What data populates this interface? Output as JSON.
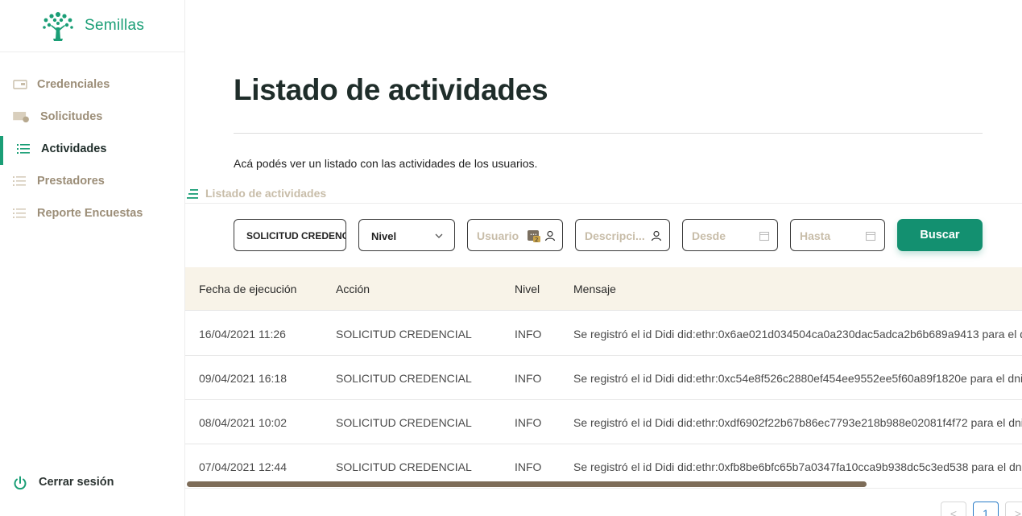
{
  "brand": {
    "name": "Semillas",
    "color": "#1a9e76"
  },
  "sidebar": {
    "items": [
      {
        "label": "Credenciales",
        "icon": "card-icon",
        "active": false
      },
      {
        "label": "Solicitudes",
        "icon": "folder-icon",
        "active": false
      },
      {
        "label": "Actividades",
        "icon": "list-icon",
        "active": true
      },
      {
        "label": "Prestadores",
        "icon": "list-icon",
        "active": false
      },
      {
        "label": "Reporte Encuestas",
        "icon": "list-icon",
        "active": false
      }
    ],
    "logout_label": "Cerrar sesión"
  },
  "main": {
    "title": "Listado de actividades",
    "subtitle": "Acá podés ver un listado con las actividades de los usuarios.",
    "section_label": "Listado de actividades"
  },
  "filters": {
    "action_value": "SOLICITUD CREDENCIAL",
    "level_value": "Nivel",
    "user_placeholder": "Usuario",
    "description_placeholder": "Descripci...",
    "from_placeholder": "Desde",
    "to_placeholder": "Hasta",
    "search_label": "Buscar"
  },
  "table": {
    "columns": [
      "Fecha de ejecución",
      "Acción",
      "Nivel",
      "Mensaje"
    ],
    "rows": [
      [
        "16/04/2021 11:26",
        "SOLICITUD CREDENCIAL",
        "INFO",
        "Se registró el id Didi did:ethr:0x6ae021d034504ca0a230dac5adca2b6b689a9413 para el d"
      ],
      [
        "09/04/2021 16:18",
        "SOLICITUD CREDENCIAL",
        "INFO",
        "Se registró el id Didi did:ethr:0xc54e8f526c2880ef454ee9552ee5f60a89f1820e para el dni"
      ],
      [
        "08/04/2021 10:02",
        "SOLICITUD CREDENCIAL",
        "INFO",
        "Se registró el id Didi did:ethr:0xdf6902f22b67b86ec7793e218b988e02081f4f72 para el dni"
      ],
      [
        "07/04/2021 12:44",
        "SOLICITUD CREDENCIAL",
        "INFO",
        "Se registró el id Didi did:ethr:0xfb8be6bfc65b7a0347fa10cca9b938dc5c3ed538 para el dni"
      ]
    ]
  },
  "pagination": {
    "prev": "<",
    "current": "1",
    "next": ">"
  },
  "colors": {
    "accent": "#139070",
    "header_bg": "#f8f3e8",
    "muted": "#9c8e78"
  }
}
